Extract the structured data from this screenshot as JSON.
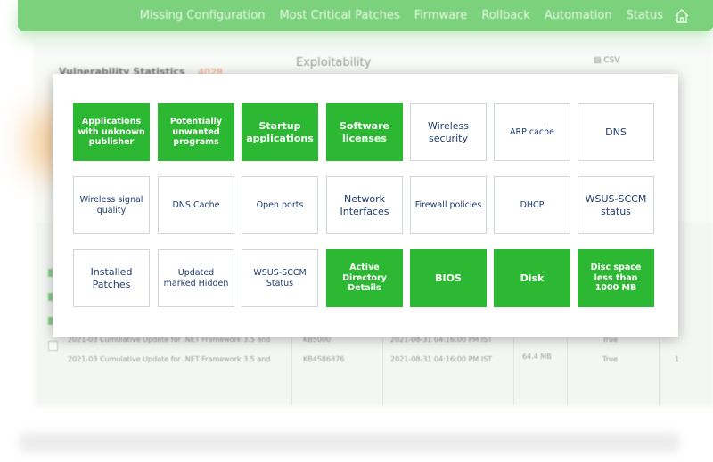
{
  "nav": {
    "items": [
      "Missing Configuration",
      "Most Critical Patches",
      "Firmware",
      "Rollback",
      "Automation",
      "Status"
    ],
    "home_icon": "home-icon",
    "bar_color": "#7cd27c"
  },
  "background": {
    "vuln_stats_label": "Vulnerability Statistics",
    "vuln_count": "4028",
    "exploitability_label": "Exploitability",
    "csv_label": "CSV",
    "rows": [
      {
        "name": "2021-03 Cumulative Update for .NET Framework 3.5 and",
        "kb": "KB5000",
        "date": "2021-08-31 04:16:00 PM IST",
        "size": "",
        "flag": "True"
      },
      {
        "name": "2021-03 Cumulative Update for .NET Framework 3.5 and",
        "kb": "KB4586876",
        "date": "2021-08-31 04:16:00 PM IST",
        "size": "64.4 MB",
        "flag": "True",
        "num": "1"
      }
    ]
  },
  "tiles": [
    {
      "label": "Applications with unknown publisher",
      "active": true
    },
    {
      "label": "Potentially unwanted programs",
      "active": true
    },
    {
      "label": "Startup applications",
      "active": true
    },
    {
      "label": "Software licenses",
      "active": true
    },
    {
      "label": "Wireless security",
      "active": false
    },
    {
      "label": "ARP cache",
      "active": false
    },
    {
      "label": "DNS",
      "active": false
    },
    {
      "label": "Wireless signal quality",
      "active": false
    },
    {
      "label": "DNS Cache",
      "active": false
    },
    {
      "label": "Open ports",
      "active": false
    },
    {
      "label": "Network Interfaces",
      "active": false
    },
    {
      "label": "Firewall policies",
      "active": false
    },
    {
      "label": "DHCP",
      "active": false
    },
    {
      "label": "WSUS-SCCM status",
      "active": false
    },
    {
      "label": "Installed Patches",
      "active": false
    },
    {
      "label": "Updated marked Hidden",
      "active": false
    },
    {
      "label": "WSUS-SCCM Status",
      "active": false
    },
    {
      "label": "Active Directory Details",
      "active": true
    },
    {
      "label": "BIOS",
      "active": true
    },
    {
      "label": "Disk",
      "active": true
    },
    {
      "label": "Disc space less than 1000 MB",
      "active": true
    }
  ],
  "colors": {
    "active_tile": "#2db834",
    "inactive_text": "#1f3c6e",
    "inactive_border": "#cfd6dc"
  }
}
